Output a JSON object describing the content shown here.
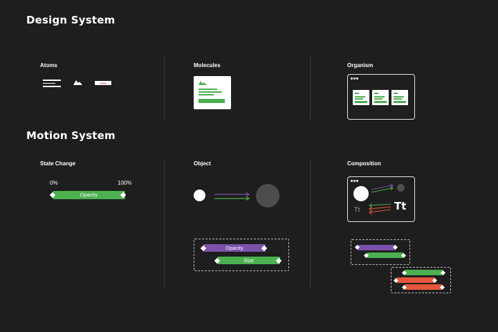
{
  "headings": {
    "design": "Design System",
    "motion": "Motion System"
  },
  "design": {
    "atoms": "Atoms",
    "molecules": "Molecules",
    "organism": "Organism"
  },
  "motion": {
    "state_change": "State Change",
    "object": "Object",
    "composition": "Composition",
    "start_label": "0%",
    "end_label": "100%",
    "opacity_bar": "Opacity",
    "object_opacity_bar": "Opacity",
    "object_size_bar": "Size",
    "type_small": "Tt",
    "type_large": "Tt"
  },
  "colors": {
    "background": "#1e1e1e",
    "green": "#4caf50",
    "purple": "#7b52ab",
    "red": "#e4573d",
    "divider": "#3a3a3a",
    "gray_circle": "#4d4d4d"
  }
}
